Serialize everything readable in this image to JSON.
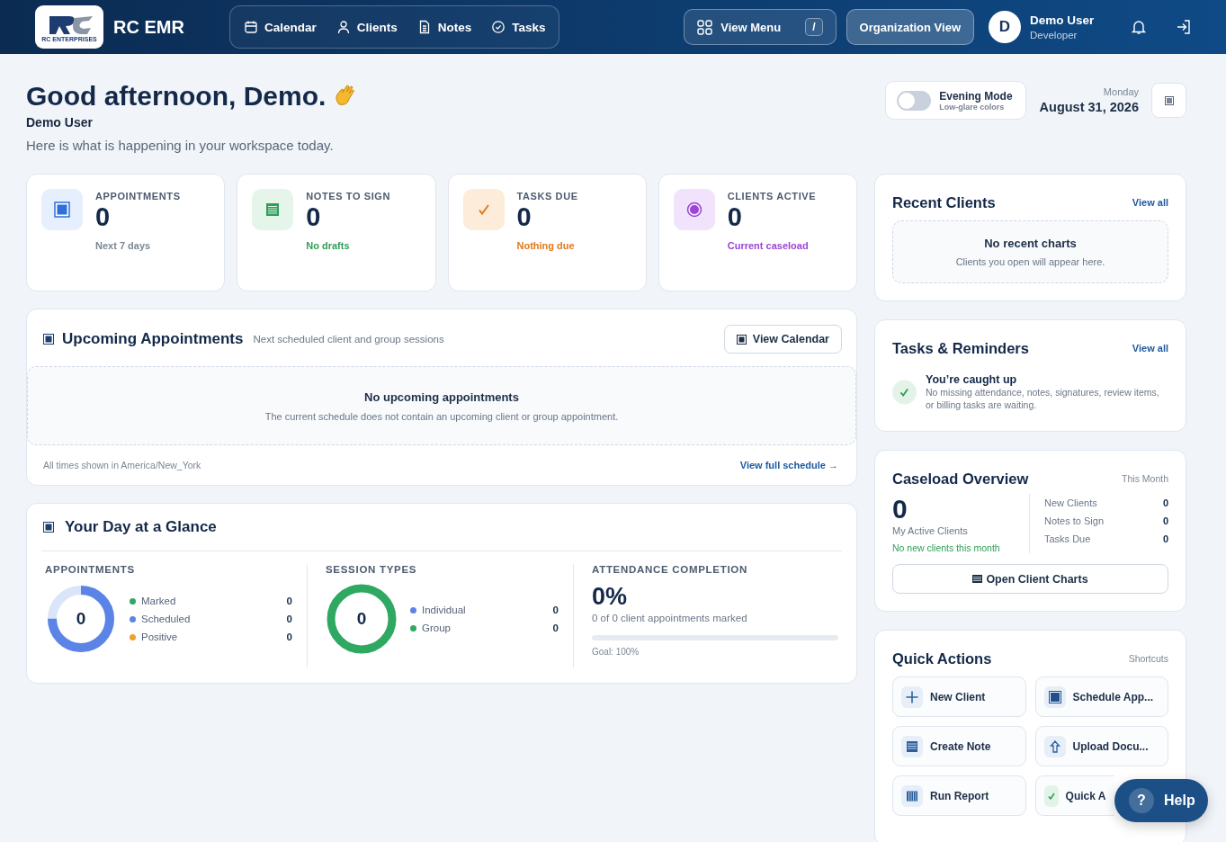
{
  "header": {
    "logo_text": "RC ENTERPRISES",
    "app_name": "RC EMR",
    "nav": [
      {
        "label": "Calendar",
        "kind": "calendar"
      },
      {
        "label": "Clients",
        "kind": "person"
      },
      {
        "label": "Notes",
        "kind": "document"
      },
      {
        "label": "Tasks",
        "kind": "check"
      }
    ],
    "view_menu": {
      "label": "View Menu",
      "shortcut": "/"
    },
    "org_view": "Organization View",
    "user": {
      "initial": "D",
      "name": "Demo User",
      "role": "Developer"
    }
  },
  "greeting": {
    "title": "Good afternoon, Demo.",
    "user": "Demo User",
    "subtitle": "Here is what is happening in your workspace today."
  },
  "evening_mode": {
    "label": "Evening Mode",
    "hint": "Low-glare colors",
    "on": false
  },
  "date": {
    "weekday": "Monday",
    "date": "August 31, 2026"
  },
  "stats": [
    {
      "kind": "appointments",
      "label": "APPOINTMENTS",
      "value": "0",
      "note": "Next 7 days",
      "color": "#7b8794"
    },
    {
      "kind": "notes",
      "label": "NOTES TO SIGN",
      "value": "0",
      "note": "No drafts",
      "color": "#2f9e58"
    },
    {
      "kind": "tasks",
      "label": "TASKS DUE",
      "value": "0",
      "note": "Nothing due",
      "color": "#e07a1f"
    },
    {
      "kind": "clients",
      "label": "CLIENTS ACTIVE",
      "value": "0",
      "note": "Current caseload",
      "color": "#9b45d6"
    }
  ],
  "upcoming": {
    "title": "Upcoming Appointments",
    "subtitle": "Next scheduled client and group sessions",
    "button": "View Calendar",
    "empty_title": "No upcoming appointments",
    "empty_text": "The current schedule does not contain an upcoming client or group appointment.",
    "timezone": "All times shown in America/New_York",
    "link": "View full schedule →"
  },
  "glance": {
    "title": "Your Day at a Glance",
    "appointments": {
      "heading": "APPOINTMENTS",
      "total": "0",
      "legend": [
        {
          "label": "Marked",
          "value": "0",
          "color": "#2fa862"
        },
        {
          "label": "Scheduled",
          "value": "0",
          "color": "#5b84e6"
        },
        {
          "label": "Positive",
          "value": "0",
          "color": "#f0a030"
        }
      ]
    },
    "sessions": {
      "heading": "SESSION TYPES",
      "total": "0",
      "legend": [
        {
          "label": "Individual",
          "value": "0",
          "color": "#5b84e6"
        },
        {
          "label": "Group",
          "value": "0",
          "color": "#2fa862"
        }
      ]
    },
    "attendance": {
      "heading": "ATTENDANCE COMPLETION",
      "percent": "0%",
      "caption": "0 of 0 client appointments marked",
      "level": 0,
      "goal": "Goal: 100%"
    }
  },
  "recent_clients": {
    "title": "Recent Clients",
    "link": "View all",
    "empty_title": "No recent charts",
    "empty_text": "Clients you open will appear here."
  },
  "tasks": {
    "title": "Tasks & Reminders",
    "link": "View all",
    "status_title": "You’re caught up",
    "status_text": "No missing attendance, notes, signatures, review items, or billing tasks are waiting."
  },
  "caseload": {
    "title": "Caseload Overview",
    "period": "This Month",
    "count": "0",
    "count_label": "My Active Clients",
    "trend": "No new clients this month",
    "rows": [
      {
        "label": "New Clients",
        "value": "0"
      },
      {
        "label": "Notes to Sign",
        "value": "0"
      },
      {
        "label": "Tasks Due",
        "value": "0"
      }
    ],
    "button": "Open Client Charts"
  },
  "quick_actions": {
    "title": "Quick Actions",
    "hint": "Shortcuts",
    "actions": [
      {
        "label": "New Client",
        "kind": "plus"
      },
      {
        "label": "Schedule App...",
        "kind": "calendar"
      },
      {
        "label": "Create Note",
        "kind": "note"
      },
      {
        "label": "Upload Docu...",
        "kind": "upload"
      },
      {
        "label": "Run Report",
        "kind": "report"
      },
      {
        "label": "Quick A",
        "kind": "check"
      }
    ]
  },
  "help": {
    "glyph": "?",
    "label": "Help"
  }
}
